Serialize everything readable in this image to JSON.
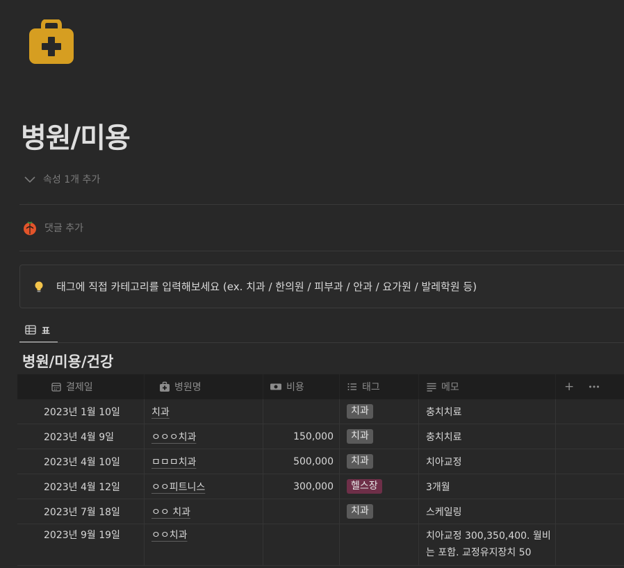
{
  "page": {
    "icon": "medical-kit-icon",
    "title": "병원/미용",
    "properties_toggle": "속성 1개 추가",
    "comment_placeholder": "댓글 추가",
    "callout": {
      "icon": "lightbulb-icon",
      "text": "태그에 직접 카테고리를 입력해보세요 (ex. 치과 / 한의원 / 피부과 / 안과 / 요가원 / 발레학원 등)"
    },
    "view_tab": {
      "icon": "table-icon",
      "label": "표"
    },
    "database_title": "병원/미용/건강"
  },
  "colors": {
    "icon_gold": "#d69e21",
    "tag_gray": "#5a5a5a",
    "tag_pink": "#6e2f48",
    "background": "#282828"
  },
  "table": {
    "columns": [
      {
        "label": "결제일",
        "icon": "calendar-icon"
      },
      {
        "label": "병원명",
        "icon": "medical-kit-icon"
      },
      {
        "label": "비용",
        "icon": "money-icon"
      },
      {
        "label": "태그",
        "icon": "list-icon"
      },
      {
        "label": "메모",
        "icon": "text-lines-icon"
      }
    ],
    "add_column": "+",
    "more_options": "•••",
    "rows": [
      {
        "date": "2023년 1월 10일",
        "name": "치과",
        "cost": "",
        "tag": "치과",
        "tag_color": "gray",
        "memo": "충치치료"
      },
      {
        "date": "2023년 4월 9일",
        "name": "ㅇㅇㅇ치과",
        "cost": "150,000",
        "tag": "치과",
        "tag_color": "gray",
        "memo": "충치치료"
      },
      {
        "date": "2023년 4월 10일",
        "name": "ㅁㅁㅁ치과",
        "cost": "500,000",
        "tag": "치과",
        "tag_color": "gray",
        "memo": "치아교정"
      },
      {
        "date": "2023년 4월 12일",
        "name": "ㅇㅇ피트니스",
        "cost": "300,000",
        "tag": "헬스장",
        "tag_color": "pink",
        "memo": "3개월"
      },
      {
        "date": "2023년 7월 18일",
        "name": "ㅇㅇ 치과",
        "cost": "",
        "tag": "치과",
        "tag_color": "gray",
        "memo": "스케일링"
      },
      {
        "date": "2023년 9월 19일",
        "name": "ㅇㅇ치과",
        "cost": "",
        "tag": "",
        "tag_color": "",
        "memo": "치아교정 300,350,400. 월비는 포함. 교정유지장치 50"
      }
    ]
  }
}
